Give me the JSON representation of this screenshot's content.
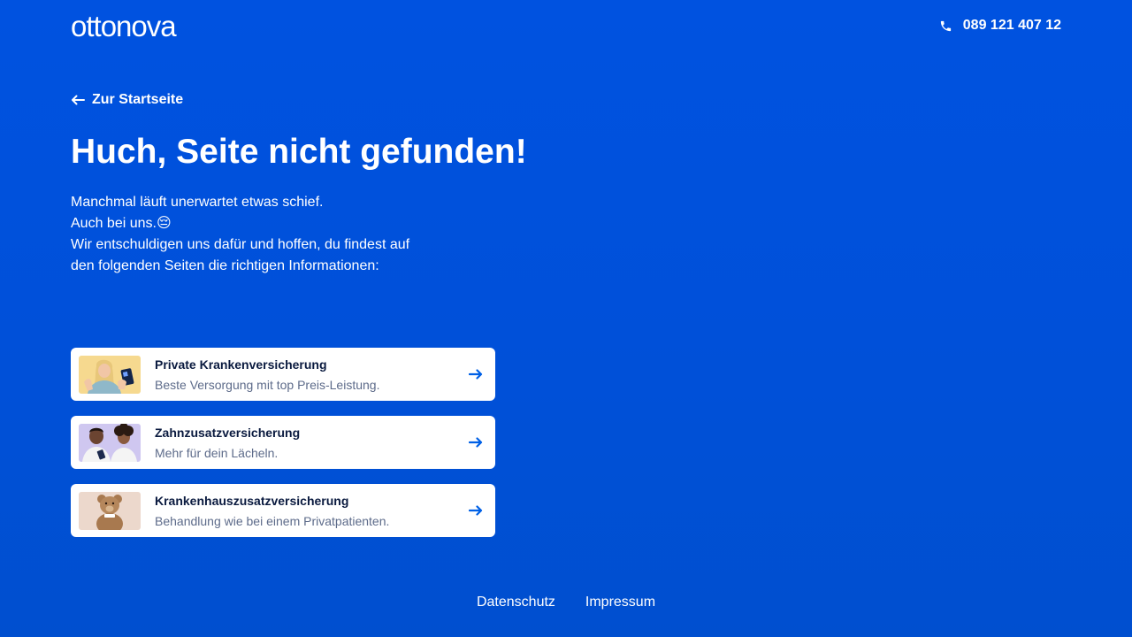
{
  "header": {
    "logo_text": "ottonova",
    "phone_number": "089 121 407 12"
  },
  "main": {
    "back_link": "Zur Startseite",
    "title": "Huch, Seite nicht gefunden!",
    "intro_lines": [
      "Manchmal läuft unerwartet etwas schief.",
      "Auch bei uns.😔",
      "Wir entschuldigen uns dafür und hoffen, du findest auf",
      "den folgenden Seiten die richtigen Informationen:"
    ],
    "cards": [
      {
        "title": "Private Krankenversicherung",
        "subtitle": "Beste Versorgung mit top Preis-Leistung.",
        "image": "woman-with-phone-photo"
      },
      {
        "title": "Zahnzusatzversicherung",
        "subtitle": "Mehr für dein Lächeln.",
        "image": "smiling-couple-photo"
      },
      {
        "title": "Krankenhauszusatzversicherung",
        "subtitle": "Behandlung wie bei einem Privatpatienten.",
        "image": "teddy-bear-photo"
      }
    ]
  },
  "footer": {
    "links": [
      "Datenschutz",
      "Impressum"
    ]
  },
  "colors": {
    "background": "#0052e0",
    "card_background": "#ffffff",
    "card_title": "#0a1a3f",
    "card_subtitle": "#5d6b8a",
    "arrow": "#0060e6"
  },
  "icons": {
    "phone": "phone-icon",
    "back": "arrow-left-icon",
    "card_arrow": "arrow-right-icon"
  }
}
